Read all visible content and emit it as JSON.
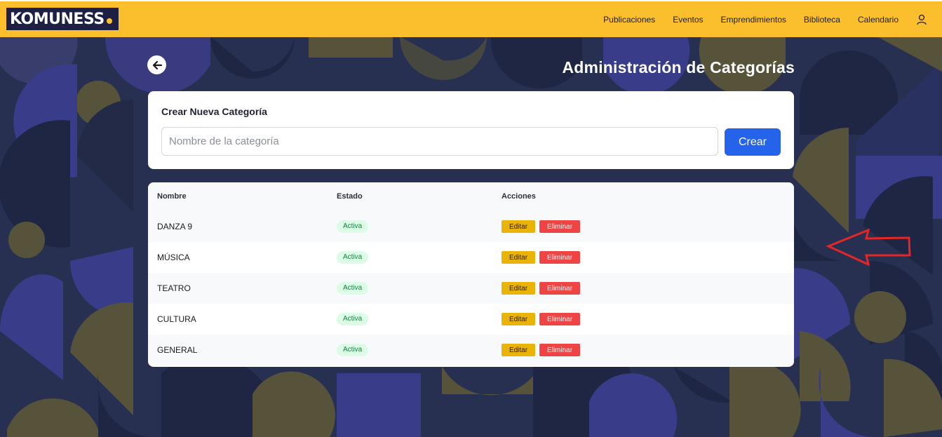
{
  "brand": {
    "name": "KOMUNESS"
  },
  "nav": {
    "links": [
      "Publicaciones",
      "Eventos",
      "Emprendimientos",
      "Biblioteca",
      "Calendario"
    ],
    "user_icon": "user-icon"
  },
  "page": {
    "title": "Administración de Categorías"
  },
  "create": {
    "title": "Crear Nueva Categoría",
    "placeholder": "Nombre de la categoría",
    "value": "",
    "button": "Crear"
  },
  "table": {
    "headers": {
      "name": "Nombre",
      "status": "Estado",
      "actions": "Acciones"
    },
    "rows": [
      {
        "name": "DANZA 9",
        "status": "Activa",
        "edit": "Editar",
        "delete": "Eliminar"
      },
      {
        "name": "MÚSICA",
        "status": "Activa",
        "edit": "Editar",
        "delete": "Eliminar"
      },
      {
        "name": "TEATRO",
        "status": "Activa",
        "edit": "Editar",
        "delete": "Eliminar"
      },
      {
        "name": "CULTURA",
        "status": "Activa",
        "edit": "Editar",
        "delete": "Eliminar"
      },
      {
        "name": "GENERAL",
        "status": "Activa",
        "edit": "Editar",
        "delete": "Eliminar"
      }
    ]
  },
  "colors": {
    "navbar": "#fbbf2d",
    "primary": "#2563eb",
    "edit": "#eab308",
    "delete": "#ef4444",
    "badge_bg": "#dcfce7",
    "badge_text": "#15803d",
    "annotation": "#e32626"
  }
}
